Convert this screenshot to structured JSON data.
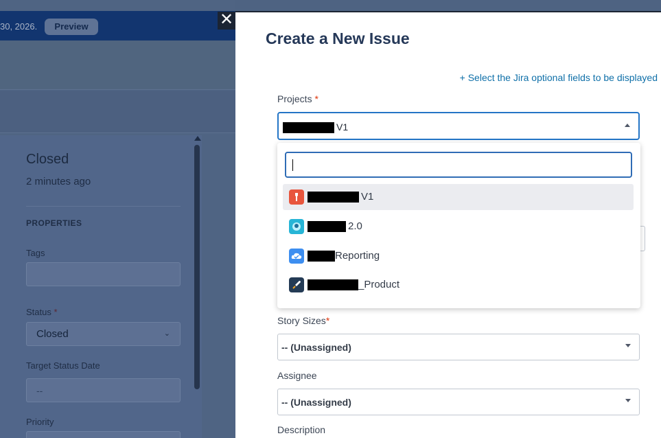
{
  "background": {
    "banner": {
      "text": "30, 2026.",
      "preview_label": "Preview"
    },
    "panel": {
      "title": "Closed",
      "subtitle": "2 minutes ago",
      "section": "PROPERTIES",
      "tags_label": "Tags",
      "status_label": "Status",
      "status_value": "Closed",
      "target_date_label": "Target Status Date",
      "target_date_value": "--",
      "priority_label": "Priority"
    }
  },
  "modal": {
    "close_glyph": "✕",
    "title": "Create a New Issue",
    "optional_fields_link": "+ Select the Jira optional fields to be displayed",
    "projects": {
      "label": "Projects",
      "required_mark": "*",
      "selected_value": "V1",
      "search_value": "",
      "options": [
        {
          "label": "V1",
          "icon": "wrench-icon",
          "color": "#e8553d"
        },
        {
          "label": "2.0",
          "icon": "robot-icon",
          "color": "#27b5d6"
        },
        {
          "label": "Reporting",
          "icon": "cloud-icon",
          "color": "#3d8ef0"
        },
        {
          "label": "_Product",
          "icon": "rocket-icon",
          "color": "#243b55"
        }
      ]
    },
    "story_sizes": {
      "label": "Story Sizes",
      "required_mark": "*",
      "value": "-- (Unassigned)"
    },
    "assignee": {
      "label": "Assignee",
      "value": "-- (Unassigned)"
    },
    "description": {
      "label": "Description"
    }
  },
  "colors": {
    "accent": "#2475c6",
    "link": "#0e6fa8",
    "banner": "#12356f",
    "required": "#de350b"
  }
}
